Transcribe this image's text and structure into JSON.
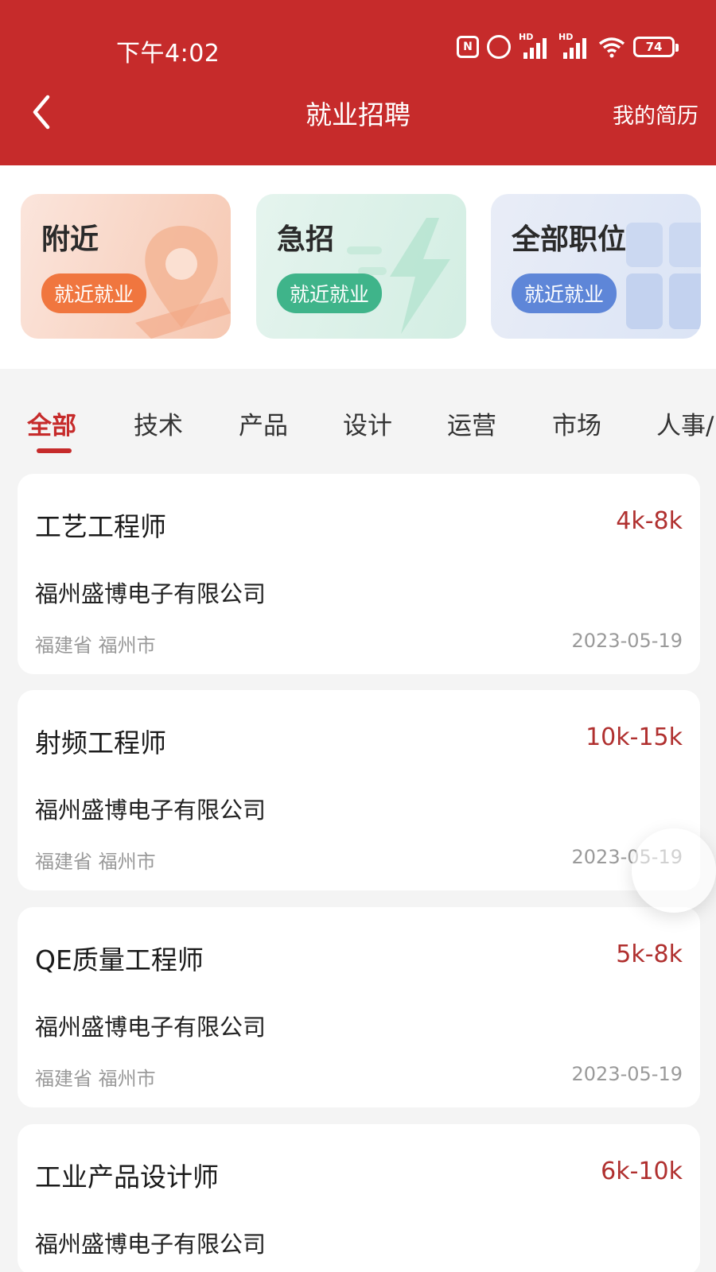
{
  "status_bar": {
    "time": "下午4:02",
    "nfc_symbol": "N",
    "alarm_symbol": "⏰",
    "signal_label": "HD",
    "wifi_symbol": "📶",
    "battery_level": "74"
  },
  "header": {
    "title": "就业招聘",
    "right_link": "我的简历",
    "accent_color": "#c62b2b"
  },
  "categories": [
    {
      "label": "附近",
      "pill": "就近就业",
      "icon": "location-pin-icon"
    },
    {
      "label": "急招",
      "pill": "就近就业",
      "icon": "lightning-icon"
    },
    {
      "label": "全部职位",
      "pill": "就近就业",
      "icon": "grid-icon"
    }
  ],
  "tabs": [
    "全部",
    "技术",
    "产品",
    "设计",
    "运营",
    "市场",
    "人事/"
  ],
  "active_tab": "全部",
  "jobs": [
    {
      "title": "工艺工程师",
      "salary": "4k-8k",
      "company": "福州盛博电子有限公司",
      "location": "福建省 福州市",
      "date": "2023-05-19"
    },
    {
      "title": "射频工程师",
      "salary": "10k-15k",
      "company": "福州盛博电子有限公司",
      "location": "福建省 福州市",
      "date": "2023-05-19"
    },
    {
      "title": "QE质量工程师",
      "salary": "5k-8k",
      "company": "福州盛博电子有限公司",
      "location": "福建省 福州市",
      "date": "2023-05-19"
    },
    {
      "title": "工业产品设计师",
      "salary": "6k-10k",
      "company": "福州盛博电子有限公司",
      "location": "",
      "date": ""
    }
  ]
}
